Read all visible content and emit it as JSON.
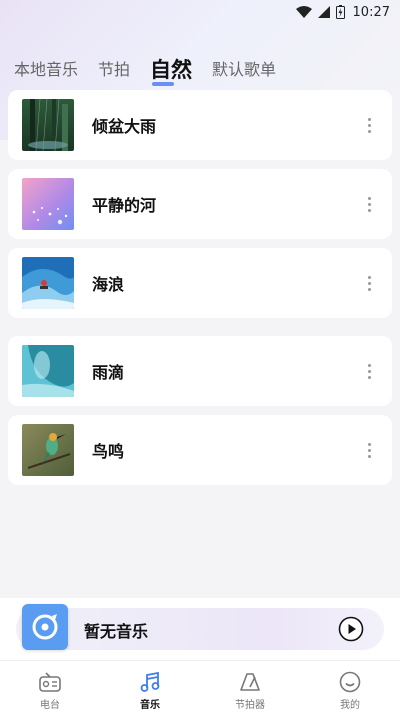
{
  "status_bar": {
    "time": "10:27"
  },
  "tabs": [
    {
      "label": "本地音乐",
      "active": false
    },
    {
      "label": "节拍",
      "active": false
    },
    {
      "label": "自然",
      "active": true
    },
    {
      "label": "默认歌单",
      "active": false
    }
  ],
  "list": {
    "items": [
      {
        "title": "倾盆大雨",
        "thumb": "rain-forest"
      },
      {
        "title": "平静的河",
        "thumb": "calm-river"
      },
      {
        "title": "海浪",
        "thumb": "ocean-wave"
      },
      {
        "title": "雨滴",
        "thumb": "raindrop"
      },
      {
        "title": "鸟鸣",
        "thumb": "bird"
      }
    ]
  },
  "mini_player": {
    "title": "暂无音乐"
  },
  "bottom_nav": [
    {
      "label": "电台",
      "icon": "radio-icon",
      "active": false
    },
    {
      "label": "音乐",
      "icon": "music-note-icon",
      "active": true
    },
    {
      "label": "节拍器",
      "icon": "metronome-icon",
      "active": false
    },
    {
      "label": "我的",
      "icon": "smiley-icon",
      "active": false
    }
  ],
  "colors": {
    "accent": "#3d7df0",
    "tab_underline": "#6a8ff0",
    "mini_art": "#5b9cf3"
  }
}
